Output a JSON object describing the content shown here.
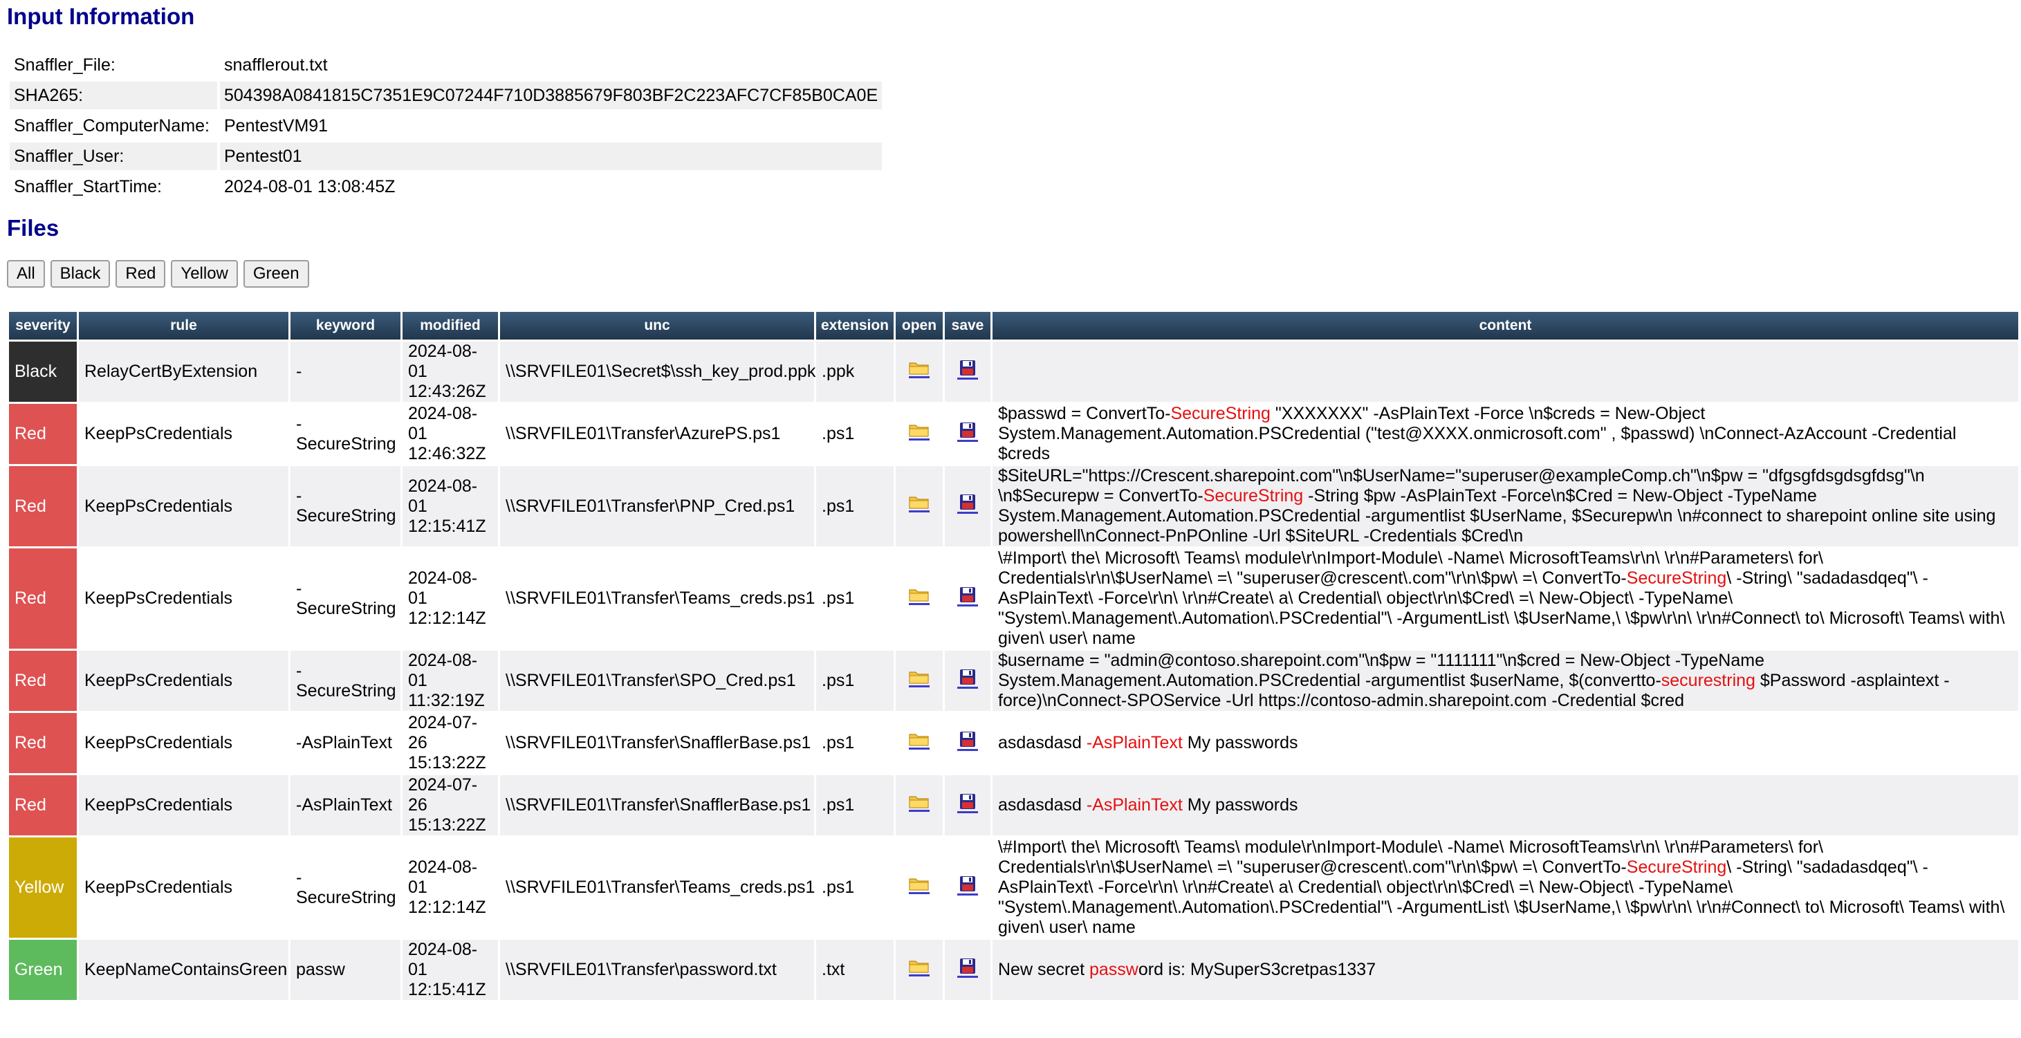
{
  "input_heading": "Input Information",
  "info": [
    {
      "key": "Snaffler_File:",
      "value": "snafflerout.txt"
    },
    {
      "key": "SHA265:",
      "value": "504398A0841815C7351E9C07244F710D3885679F803BF2C223AFC7CF85B0CA0E"
    },
    {
      "key": "Snaffler_ComputerName:",
      "value": "PentestVM91"
    },
    {
      "key": "Snaffler_User:",
      "value": "Pentest01"
    },
    {
      "key": "Snaffler_StartTime:",
      "value": "2024-08-01 13:08:45Z"
    }
  ],
  "files_heading": "Files",
  "filters": [
    "All",
    "Black",
    "Red",
    "Yellow",
    "Green"
  ],
  "columns": [
    "severity",
    "rule",
    "keyword",
    "modified",
    "unc",
    "extension",
    "open",
    "save",
    "content"
  ],
  "colors": {
    "Black": "#2e2e2e",
    "Red": "#de5252",
    "Yellow": "#cdab07",
    "Green": "#5dbb5d",
    "highlight": "#e41010",
    "heading": "#00008b"
  },
  "icons": {
    "open": "folder-icon",
    "save": "floppy-disk-icon"
  },
  "rows": [
    {
      "severity": "Black",
      "rule": "RelayCertByExtension",
      "keyword": "-",
      "modified": "2024-08-01 12:43:26Z",
      "unc": "\\\\SRVFILE01\\Secret$\\ssh_key_prod.ppk",
      "extension": ".ppk",
      "content": []
    },
    {
      "severity": "Red",
      "rule": "KeepPsCredentials",
      "keyword": "-SecureString",
      "modified": "2024-08-01 12:46:32Z",
      "unc": "\\\\SRVFILE01\\Transfer\\AzurePS.ps1",
      "extension": ".ps1",
      "content": [
        {
          "t": "$passwd = ConvertTo-"
        },
        {
          "t": "SecureString",
          "h": true
        },
        {
          "t": " \"XXXXXXX\" -AsPlainText -Force \\n$creds = New-Object System.Management.Automation.PSCredential (\"test@XXXX.onmicrosoft.com\" , $passwd) \\nConnect-AzAccount -Credential $creds"
        }
      ]
    },
    {
      "severity": "Red",
      "rule": "KeepPsCredentials",
      "keyword": "-SecureString",
      "modified": "2024-08-01 12:15:41Z",
      "unc": "\\\\SRVFILE01\\Transfer\\PNP_Cred.ps1",
      "extension": ".ps1",
      "content": [
        {
          "t": "$SiteURL=\"https://Crescent.sharepoint.com\"\\n$UserName=\"superuser@exampleComp.ch\"\\n$pw = \"dfgsgfdsgdsgfdsg\"\\n \\n$Securepw = ConvertTo-"
        },
        {
          "t": "SecureString",
          "h": true
        },
        {
          "t": " -String $pw -AsPlainText -Force\\n$Cred = New-Object -TypeName System.Management.Automation.PSCredential -argumentlist $UserName, $Securepw\\n \\n#connect to sharepoint online site using powershell\\nConnect-PnPOnline -Url $SiteURL -Credentials $Cred\\n"
        }
      ]
    },
    {
      "severity": "Red",
      "rule": "KeepPsCredentials",
      "keyword": "-SecureString",
      "modified": "2024-08-01 12:12:14Z",
      "unc": "\\\\SRVFILE01\\Transfer\\Teams_creds.ps1",
      "extension": ".ps1",
      "content": [
        {
          "t": "\\#Import\\ the\\ Microsoft\\ Teams\\ module\\r\\nImport-Module\\ -Name\\ MicrosoftTeams\\r\\n\\ \\r\\n#Parameters\\ for\\ Credentials\\r\\n\\$UserName\\ =\\ \"superuser@crescent\\.com\"\\r\\n\\$pw\\ =\\ ConvertTo-"
        },
        {
          "t": "SecureString",
          "h": true
        },
        {
          "t": "\\ -String\\ \"sadadasdqeq\"\\ -AsPlainText\\ -Force\\r\\n\\ \\r\\n#Create\\ a\\ Credential\\ object\\r\\n\\$Cred\\ =\\ New-Object\\ -TypeName\\ \"System\\.Management\\.Automation\\.PSCredential\"\\ -ArgumentList\\ \\$UserName,\\ \\$pw\\r\\n\\ \\r\\n#Connect\\ to\\ Microsoft\\ Teams\\ with\\ given\\ user\\ name"
        }
      ]
    },
    {
      "severity": "Red",
      "rule": "KeepPsCredentials",
      "keyword": "-SecureString",
      "modified": "2024-08-01 11:32:19Z",
      "unc": "\\\\SRVFILE01\\Transfer\\SPO_Cred.ps1",
      "extension": ".ps1",
      "content": [
        {
          "t": "$username = \"admin@contoso.sharepoint.com\"\\n$pw = \"1111111\"\\n$cred = New-Object -TypeName System.Management.Automation.PSCredential -argumentlist $userName, $(convertto-"
        },
        {
          "t": "securestring",
          "h": true
        },
        {
          "t": " $Password -asplaintext -force)\\nConnect-SPOService -Url https://contoso-admin.sharepoint.com -Credential $cred"
        }
      ]
    },
    {
      "severity": "Red",
      "rule": "KeepPsCredentials",
      "keyword": "-AsPlainText",
      "modified": "2024-07-26 15:13:22Z",
      "unc": "\\\\SRVFILE01\\Transfer\\SnafflerBase.ps1",
      "extension": ".ps1",
      "content": [
        {
          "t": "asdasdasd "
        },
        {
          "t": "-AsPlainText",
          "h": true
        },
        {
          "t": " My passwords"
        }
      ]
    },
    {
      "severity": "Red",
      "rule": "KeepPsCredentials",
      "keyword": "-AsPlainText",
      "modified": "2024-07-26 15:13:22Z",
      "unc": "\\\\SRVFILE01\\Transfer\\SnafflerBase.ps1",
      "extension": ".ps1",
      "content": [
        {
          "t": "asdasdasd "
        },
        {
          "t": "-AsPlainText",
          "h": true
        },
        {
          "t": " My passwords"
        }
      ]
    },
    {
      "severity": "Yellow",
      "rule": "KeepPsCredentials",
      "keyword": "-SecureString",
      "modified": "2024-08-01 12:12:14Z",
      "unc": "\\\\SRVFILE01\\Transfer\\Teams_creds.ps1",
      "extension": ".ps1",
      "content": [
        {
          "t": "\\#Import\\ the\\ Microsoft\\ Teams\\ module\\r\\nImport-Module\\ -Name\\ MicrosoftTeams\\r\\n\\ \\r\\n#Parameters\\ for\\ Credentials\\r\\n\\$UserName\\ =\\ \"superuser@crescent\\.com\"\\r\\n\\$pw\\ =\\ ConvertTo-"
        },
        {
          "t": "SecureString",
          "h": true
        },
        {
          "t": "\\ -String\\ \"sadadasdqeq\"\\ -AsPlainText\\ -Force\\r\\n\\ \\r\\n#Create\\ a\\ Credential\\ object\\r\\n\\$Cred\\ =\\ New-Object\\ -TypeName\\ \"System\\.Management\\.Automation\\.PSCredential\"\\ -ArgumentList\\ \\$UserName,\\ \\$pw\\r\\n\\ \\r\\n#Connect\\ to\\ Microsoft\\ Teams\\ with\\ given\\ user\\ name"
        }
      ]
    },
    {
      "severity": "Green",
      "rule": "KeepNameContainsGreen",
      "keyword": "passw",
      "modified": "2024-08-01 12:15:41Z",
      "unc": "\\\\SRVFILE01\\Transfer\\password.txt",
      "extension": ".txt",
      "content": [
        {
          "t": "New secret "
        },
        {
          "t": "passw",
          "h": true
        },
        {
          "t": "ord is: MySuperS3cretpas1337"
        }
      ]
    }
  ]
}
